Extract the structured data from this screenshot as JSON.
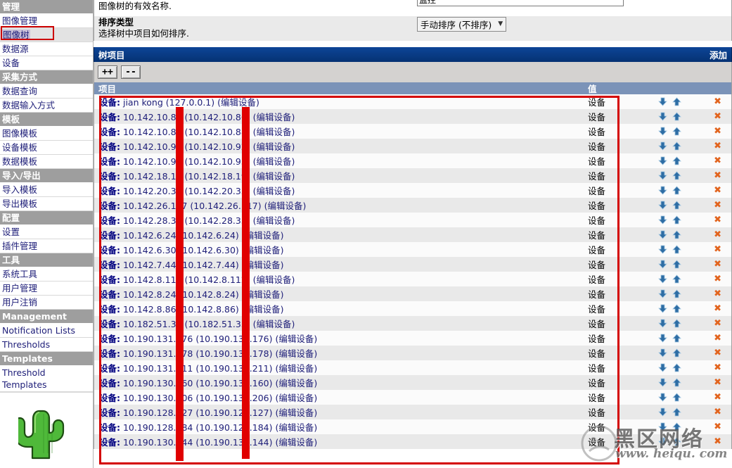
{
  "sidebar": {
    "sections": [
      {
        "type": "header",
        "label": "管理"
      },
      {
        "type": "item",
        "label": "图像管理",
        "selected": false
      },
      {
        "type": "item",
        "label": "图像树",
        "selected": true
      },
      {
        "type": "item",
        "label": "数据源",
        "selected": false
      },
      {
        "type": "item",
        "label": "设备",
        "selected": false
      },
      {
        "type": "header",
        "label": "采集方式"
      },
      {
        "type": "item",
        "label": "数据查询",
        "selected": false
      },
      {
        "type": "item",
        "label": "数据输入方式",
        "selected": false
      },
      {
        "type": "header",
        "label": "模板"
      },
      {
        "type": "item",
        "label": "图像模板",
        "selected": false
      },
      {
        "type": "item",
        "label": "设备模板",
        "selected": false
      },
      {
        "type": "item",
        "label": "数据模板",
        "selected": false
      },
      {
        "type": "header",
        "label": "导入/导出"
      },
      {
        "type": "item",
        "label": "导入模板",
        "selected": false
      },
      {
        "type": "item",
        "label": "导出模板",
        "selected": false
      },
      {
        "type": "header",
        "label": "配置"
      },
      {
        "type": "item",
        "label": "设置",
        "selected": false
      },
      {
        "type": "item",
        "label": "插件管理",
        "selected": false
      },
      {
        "type": "header",
        "label": "工具"
      },
      {
        "type": "item",
        "label": "系统工具",
        "selected": false
      },
      {
        "type": "item",
        "label": "用户管理",
        "selected": false
      },
      {
        "type": "item",
        "label": "用户注销",
        "selected": false
      },
      {
        "type": "header",
        "label": "Management"
      },
      {
        "type": "item",
        "label": "Notification Lists",
        "selected": false
      },
      {
        "type": "item",
        "label": "Thresholds",
        "selected": false
      },
      {
        "type": "header",
        "label": "Templates"
      },
      {
        "type": "item",
        "label": "Threshold Templates",
        "selected": false,
        "twoline": true
      }
    ],
    "logo_name": "cacti-cactus-logo"
  },
  "form": {
    "name_desc": "图像树的有效名称.",
    "name_value": "监控",
    "sort_title": "排序类型",
    "sort_desc": "选择树中项目如何排序.",
    "sort_value": "手动排序 (不排序)"
  },
  "tree_panel": {
    "title": "树项目",
    "add_label": "添加",
    "expand_all_label": "++",
    "collapse_all_label": "--",
    "columns": {
      "item": "项目",
      "value": "值"
    }
  },
  "rows": [
    {
      "prefix": "设备:",
      "text": " jian kong (127.0.0.1) (编辑设备)",
      "value": "设备"
    },
    {
      "prefix": "设备:",
      "text": " 10.142.10.86 (10.142.10.86) (编辑设备)",
      "value": "设备"
    },
    {
      "prefix": "设备:",
      "text": " 10.142.10.88 (10.142.10.88) (编辑设备)",
      "value": "设备"
    },
    {
      "prefix": "设备:",
      "text": " 10.142.10.92 (10.142.10.92) (编辑设备)",
      "value": "设备"
    },
    {
      "prefix": "设备:",
      "text": " 10.142.10.93 (10.142.10.93) (编辑设备)",
      "value": "设备"
    },
    {
      "prefix": "设备:",
      "text": " 10.142.18.19 (10.142.18.19) (编辑设备)",
      "value": "设备"
    },
    {
      "prefix": "设备:",
      "text": " 10.142.20.33 (10.142.20.33) (编辑设备)",
      "value": "设备"
    },
    {
      "prefix": "设备:",
      "text": " 10.142.26.117 (10.142.26.117) (编辑设备)",
      "value": "设备"
    },
    {
      "prefix": "设备:",
      "text": " 10.142.28.33 (10.142.28.33) (编辑设备)",
      "value": "设备"
    },
    {
      "prefix": "设备:",
      "text": " 10.142.6.24 (10.142.6.24) (编辑设备)",
      "value": "设备"
    },
    {
      "prefix": "设备:",
      "text": " 10.142.6.30 (10.142.6.30) (编辑设备)",
      "value": "设备"
    },
    {
      "prefix": "设备:",
      "text": " 10.142.7.44 (10.142.7.44) (编辑设备)",
      "value": "设备"
    },
    {
      "prefix": "设备:",
      "text": " 10.142.8.112 (10.142.8.112) (编辑设备)",
      "value": "设备"
    },
    {
      "prefix": "设备:",
      "text": " 10.142.8.24 (10.142.8.24) (编辑设备)",
      "value": "设备"
    },
    {
      "prefix": "设备:",
      "text": " 10.142.8.86 (10.142.8.86) (编辑设备)",
      "value": "设备"
    },
    {
      "prefix": "设备:",
      "text": " 10.182.51.33 (10.182.51.33) (编辑设备)",
      "value": "设备"
    },
    {
      "prefix": "设备:",
      "text": " 10.190.131.176 (10.190.131.176) (编辑设备)",
      "value": "设备"
    },
    {
      "prefix": "设备:",
      "text": " 10.190.131.178 (10.190.131.178) (编辑设备)",
      "value": "设备"
    },
    {
      "prefix": "设备:",
      "text": " 10.190.131.211 (10.190.131.211) (编辑设备)",
      "value": "设备"
    },
    {
      "prefix": "设备:",
      "text": " 10.190.130.160 (10.190.130.160) (编辑设备)",
      "value": "设备"
    },
    {
      "prefix": "设备:",
      "text": " 10.190.130.206 (10.190.130.206) (编辑设备)",
      "value": "设备"
    },
    {
      "prefix": "设备:",
      "text": " 10.190.128.127 (10.190.128.127) (编辑设备)",
      "value": "设备"
    },
    {
      "prefix": "设备:",
      "text": " 10.190.128.184 (10.190.128.184) (编辑设备)",
      "value": "设备"
    },
    {
      "prefix": "设备:",
      "text": " 10.190.130.144 (10.190.130.144) (编辑设备)",
      "value": "设备"
    }
  ],
  "watermark": {
    "text": "黑区网络",
    "url": "www. heiqu. com"
  },
  "colors": {
    "title_bar": "#0b3c8c",
    "column_header": "#7b93b8",
    "nav_header": "#9e9e9e",
    "link": "#20207a",
    "annotation_red": "#d40000",
    "delete_orange": "#e2641e",
    "arrow_blue": "#2e6da4"
  }
}
